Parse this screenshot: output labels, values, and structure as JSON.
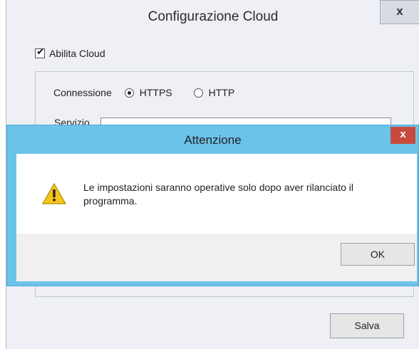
{
  "main_window": {
    "title": "Configurazione Cloud",
    "close_glyph": "x",
    "enable_cloud": {
      "label": "Abilita Cloud",
      "checked": true
    },
    "connection": {
      "label": "Connessione",
      "options": [
        {
          "label": "HTTPS",
          "selected": true
        },
        {
          "label": "HTTP",
          "selected": false
        }
      ]
    },
    "service": {
      "label": "Servizio"
    },
    "save_button": "Salva"
  },
  "dialog": {
    "title": "Attenzione",
    "close_glyph": "x",
    "icon": "warning-icon",
    "message": "Le impostazioni saranno operative solo dopo aver rilanciato il programma.",
    "ok_button": "OK"
  },
  "colors": {
    "dialog_frame": "#6cc3ea",
    "close_button": "#c74a3c",
    "window_bg": "#eef0f5"
  }
}
